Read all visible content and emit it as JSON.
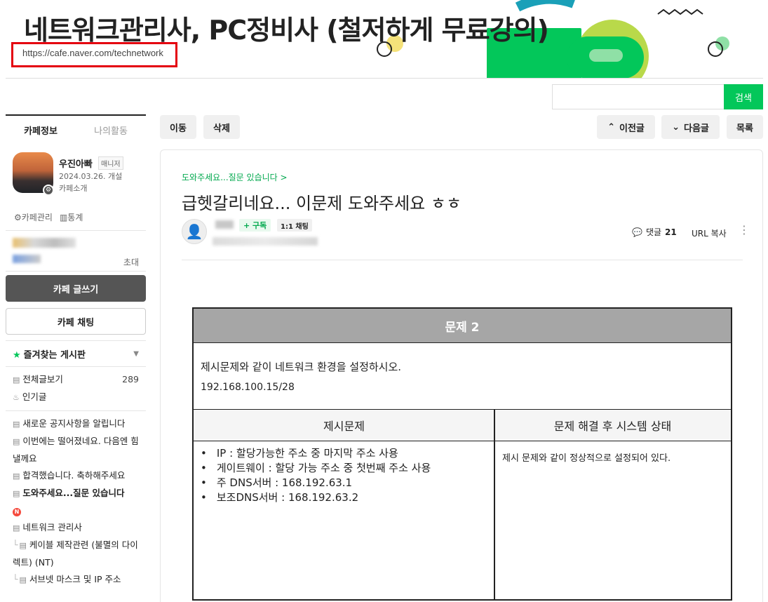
{
  "banner": {
    "title": "네트워크관리사, PC정비사 (철저하게 무료강의)",
    "url": "https://cafe.naver.com/technetwork",
    "colors": {
      "green": "#03c75a",
      "lime": "#b9d94a",
      "teal": "#1aa0b8",
      "yellow": "#f5e27a"
    }
  },
  "search": {
    "placeholder": "",
    "button_label": "검색"
  },
  "sidebar": {
    "tabs": [
      {
        "label": "카페정보"
      },
      {
        "label": "나의활동"
      }
    ],
    "profile": {
      "name": "우진아빠",
      "badge": "매니저",
      "date": "2024.03.26. 개설",
      "intro": "카페소개"
    },
    "tools": [
      {
        "label": "카페관리",
        "icon": "gear-icon"
      },
      {
        "label": "통계",
        "icon": "chart-icon"
      }
    ],
    "invite_label": "초대",
    "write_button": "카페 글쓰기",
    "chat_button": "카페 채팅",
    "favorites_label": "즐겨찾는 게시판",
    "menu_top": [
      {
        "label": "전체글보기",
        "count": "289",
        "icon": "board-icon"
      },
      {
        "label": "인기글",
        "count": "",
        "icon": "fire-icon"
      }
    ],
    "menu_boards": [
      {
        "label": "새로운 공지사항을 알립니다",
        "icon": "board-icon"
      },
      {
        "label": "이번에는 떨어졌네요. 다음엔 힘낼께요",
        "icon": "board-icon"
      },
      {
        "label": "합격했습니다. 축하해주세요",
        "icon": "board-icon"
      },
      {
        "label": "도와주세요...질문 있습니다",
        "icon": "board-icon",
        "bold": true,
        "new": "N"
      },
      {
        "label": "네트워크 관리사",
        "icon": "board-icon"
      }
    ],
    "menu_sub": [
      {
        "label": "케이블 제작관련 (불멸의 다이렉트) (NT)"
      },
      {
        "label": "서브넷 마스크 및 IP 주소"
      }
    ]
  },
  "toolbar": {
    "move": "이동",
    "delete": "삭제",
    "prev": "이전글",
    "next": "다음글",
    "list": "목록"
  },
  "article": {
    "breadcrumb": "도와주세요...질문 있습니다 >",
    "title": "급헷갈리네요... 이문제 도와주세요 ㅎㅎ",
    "subscribe": "+ 구독",
    "chat": "1:1 채팅",
    "comment_label": "댓글",
    "comment_count": "21",
    "url_copy": "URL 복사",
    "problem": {
      "header": "문제 2",
      "description": "제시문제와 같이 네트워크 환경을 설정하시오.",
      "ip": "192.168.100.15/28",
      "col_left": "제시문제",
      "col_right": "문제 해결 후 시스템 상태",
      "bullets": [
        "IP : 할당가능한 주소 중 마지막 주소 사용",
        "게이트웨이 : 할당 가능 주소 중 첫번째 주소 사용",
        "주 DNS서버 : 168.192.63.1",
        "보조DNS서버 : 168.192.63.2"
      ],
      "status": "제시 문제와 같이 정상적으로 설정되어 있다."
    }
  }
}
